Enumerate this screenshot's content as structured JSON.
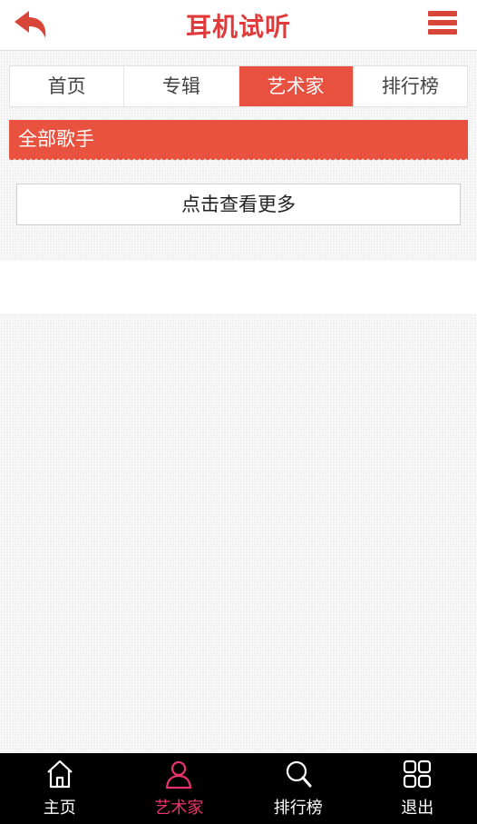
{
  "header": {
    "title": "耳机试听",
    "back_icon": "back-arrow-icon",
    "menu_icon": "hamburger-menu-icon",
    "accent": "#e03a3a"
  },
  "tabs": [
    {
      "label": "首页",
      "active": false
    },
    {
      "label": "专辑",
      "active": false
    },
    {
      "label": "艺术家",
      "active": true
    },
    {
      "label": "排行榜",
      "active": false
    }
  ],
  "section": {
    "title": "全部歌手",
    "color": "#e8523f"
  },
  "more_button": {
    "label": "点击查看更多"
  },
  "bottom_nav": {
    "items": [
      {
        "label": "主页",
        "icon": "home-icon",
        "active": false
      },
      {
        "label": "艺术家",
        "icon": "person-icon",
        "active": true
      },
      {
        "label": "排行榜",
        "icon": "search-icon",
        "active": false
      },
      {
        "label": "退出",
        "icon": "grid-icon",
        "active": false
      }
    ],
    "active_color": "#e8336e"
  }
}
